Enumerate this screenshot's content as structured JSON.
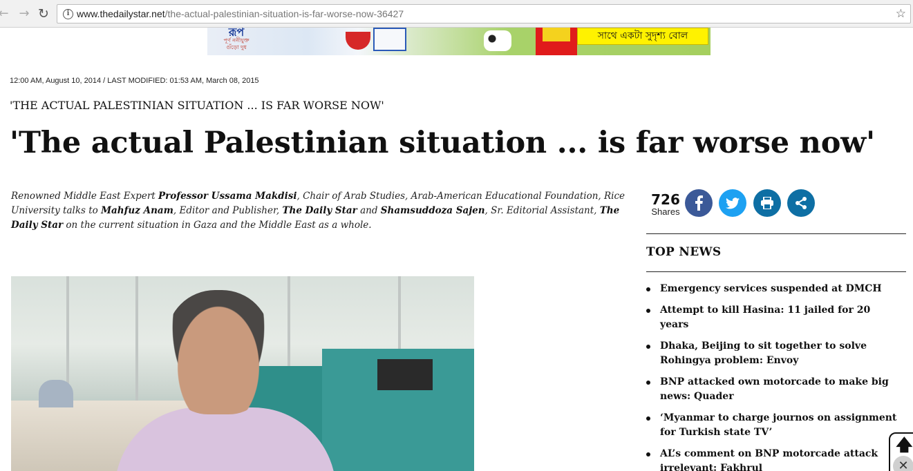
{
  "browser": {
    "url_domain": "www.thedailystar.net",
    "url_path": "/the-actual-palestinian-situation-is-far-worse-now-36427"
  },
  "ad": {
    "logo_text": "রূপ",
    "logo_sub": "পূর্ণ ননীযুক্ত গুঁড়ো দুধ",
    "tagline": "সাথে একটা সুদৃশ্য বোল"
  },
  "article": {
    "meta": "12:00 AM, August 10, 2014 / LAST MODIFIED: 01:53 AM, March 08, 2015",
    "shoulder": "'THE ACTUAL PALESTINIAN SITUATION ... IS FAR WORSE NOW'",
    "headline": "'The actual Palestinian situation ... is far worse now'",
    "intro": {
      "t1": "Renowned Middle East Expert  ",
      "b1": "Professor Ussama Makdisi",
      "t2": ", Chair of Arab Studies, Arab-American Educational Foundation, Rice University talks to ",
      "b2": "Mahfuz Anam",
      "t3": ", Editor and Publisher, ",
      "b3": "The Daily Star",
      "t4": " and ",
      "b4": "Shamsuddoza Sajen",
      "t5": ", Sr. Editorial Assistant, ",
      "b5": "The Daily Star",
      "t6": " on  the current situation in Gaza and the Middle East as a whole."
    }
  },
  "share": {
    "count": "726",
    "label": "Shares",
    "buttons": [
      "facebook",
      "twitter",
      "print",
      "share"
    ]
  },
  "top_news": {
    "title": "TOP NEWS",
    "items": [
      "Emergency services suspended at DMCH",
      "Attempt to kill Hasina: 11 jailed for 20 years",
      "Dhaka, Beijing to sit together to solve Rohingya problem: Envoy",
      "BNP attacked own motorcade to make big news: Quader",
      "‘Myanmar to charge journos on assignment for Turkish state TV’",
      "AL’s comment on BNP motorcade attack irrelevant: Fakhrul"
    ]
  },
  "colors": {
    "facebook": "#3b5998",
    "twitter": "#1da1f2",
    "print": "#0e6fa4",
    "share": "#0e6fa4"
  },
  "icons": {
    "back": "arrow-left-icon",
    "forward": "arrow-right-icon",
    "reload": "reload-icon",
    "info": "info-icon",
    "bookmark": "star-icon",
    "scroll_top": "arrow-up-icon",
    "close": "close-icon"
  }
}
